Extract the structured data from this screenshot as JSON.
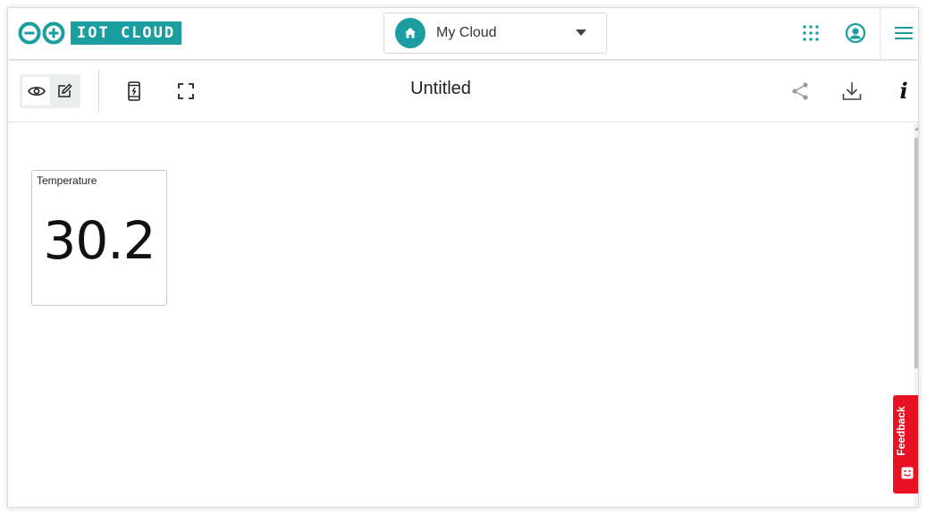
{
  "header": {
    "logo_text": "IOT CLOUD",
    "logo_icon": "arduino-infinity-logo",
    "space": {
      "name": "My Cloud",
      "icon": "home-icon"
    },
    "icons": [
      "apps-grid-icon",
      "user-account-icon",
      "hamburger-menu-icon"
    ]
  },
  "toolbar": {
    "title": "Untitled",
    "mode_icons": [
      "eye-icon",
      "pencil-edit-icon"
    ],
    "icons": [
      "mobile-view-icon",
      "fullscreen-icon",
      "share-icon",
      "download-icon",
      "info-icon"
    ],
    "info_glyph": "i"
  },
  "widget": {
    "title": "Temperature",
    "value": "30.2"
  },
  "feedback": {
    "label": "Feedback"
  },
  "colors": {
    "brand_teal": "#1a9ea0",
    "feedback_red": "#e81123"
  }
}
